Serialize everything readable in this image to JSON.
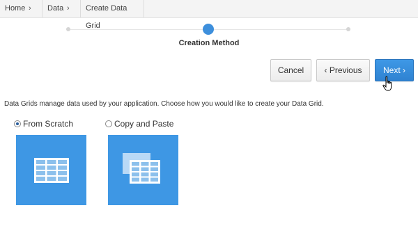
{
  "breadcrumb": {
    "items": [
      {
        "label": "Home",
        "chevron": "›"
      },
      {
        "label": "Data",
        "chevron": "›"
      },
      {
        "label": "Create Data Grid"
      }
    ]
  },
  "wizard": {
    "step_label": "Creation Method"
  },
  "buttons": {
    "cancel": "Cancel",
    "previous": "Previous",
    "previous_chevron": "‹",
    "next": "Next",
    "next_chevron": "›"
  },
  "description": "Data Grids manage data used by your application. Choose how you would like to create your Data Grid.",
  "options": [
    {
      "label": "From Scratch",
      "selected": true,
      "icon": "grid-icon"
    },
    {
      "label": "Copy and Paste",
      "selected": false,
      "icon": "copy-grid-icon"
    }
  ],
  "colors": {
    "accent": "#3e97e4",
    "active_step": "#3d8fdc"
  }
}
